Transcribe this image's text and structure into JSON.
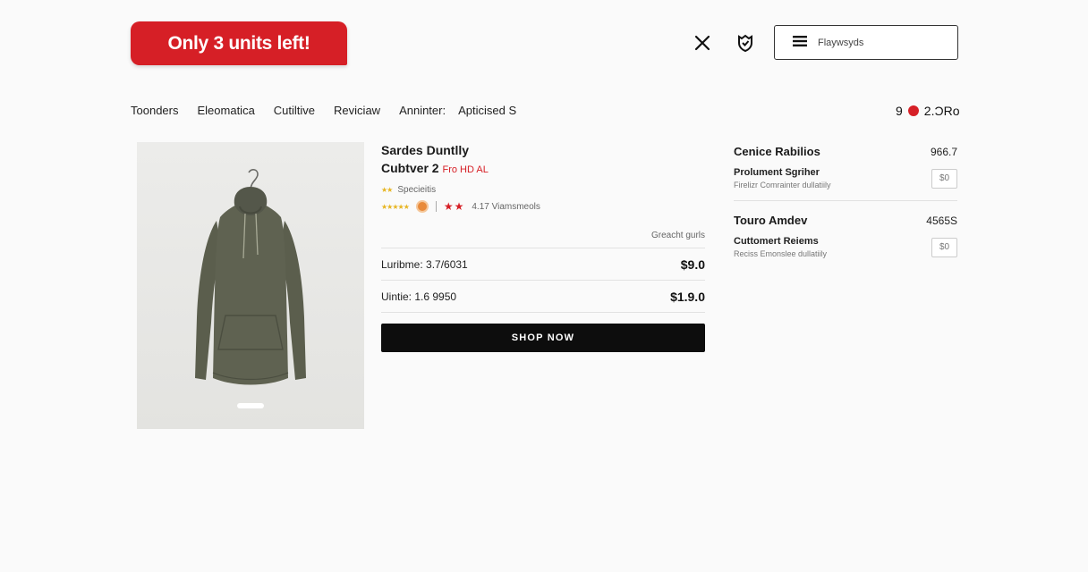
{
  "header": {
    "promo": "Only 3 units left!",
    "menu_label": "Flaywsyds",
    "icons": [
      "close-icon",
      "shield-icon",
      "hamburger-menu-icon"
    ]
  },
  "nav": {
    "items": [
      "Toonders",
      "Eleomatica",
      "Cutiltive",
      "Reviciaw",
      "Anninter:",
      "Apticised S"
    ]
  },
  "cart": {
    "count": "9",
    "total": "2.ƆRo"
  },
  "product": {
    "title_line1": "Sardes Duntlly",
    "title_line2": "Cubtver 2",
    "title_tag": "Fro HD AL",
    "meta1": "Specieitis",
    "rating_text": "4.17 Viamsmeols",
    "caption": "Greacht gurls",
    "rows": [
      {
        "label": "Luribme: 3.7/6031",
        "price": "$9.0"
      },
      {
        "label": "Uintie: 1.6 9950",
        "price": "$1.9.0"
      }
    ],
    "cta": "SHOP NOW"
  },
  "side": {
    "sections": [
      {
        "title": "Cenice Rabilios",
        "value": "966.7",
        "item_title": "Prolument Sgriher",
        "item_sub": "Firelizr Comrainter dullatiily",
        "qty": "$0"
      },
      {
        "title": "Touro Amdev",
        "value": "4565S",
        "item_title": "Cuttomert Reiems",
        "item_sub": "Reciss Emonslee dullatiily",
        "qty": "$0"
      }
    ]
  },
  "colors": {
    "accent_red": "#d61f26",
    "cta_black": "#0d0d0d",
    "hoodie": "#5e6150"
  }
}
